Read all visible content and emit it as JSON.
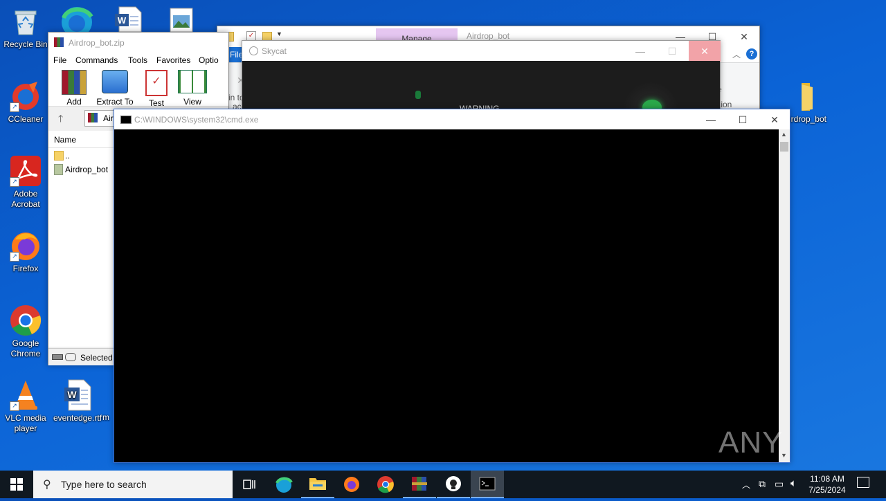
{
  "desktop": {
    "icons": [
      {
        "label": "Recycle Bin",
        "icon": "recycle-bin-icon"
      },
      {
        "label": "CCleaner",
        "icon": "ccleaner-icon"
      },
      {
        "label": "Adobe Acrobat",
        "icon": "adobe-acrobat-icon"
      },
      {
        "label": "Firefox",
        "icon": "firefox-icon"
      },
      {
        "label": "Google Chrome",
        "icon": "chrome-icon"
      },
      {
        "label": "VLC media player",
        "icon": "vlc-icon"
      },
      {
        "label": "eventedge.rtf",
        "icon": "word-document-icon"
      },
      {
        "label": "m",
        "icon": "document-icon"
      },
      {
        "label": "irdrop_bot",
        "icon": "folder-icon"
      }
    ]
  },
  "winrar": {
    "title": "Airdrop_bot.zip",
    "menu": [
      "File",
      "Commands",
      "Tools",
      "Favorites",
      "Optio"
    ],
    "toolbar": [
      {
        "label": "Add",
        "icon": "add-archive-icon"
      },
      {
        "label": "Extract To",
        "icon": "extract-icon"
      },
      {
        "label": "Test",
        "icon": "test-icon"
      },
      {
        "label": "View",
        "icon": "view-book-icon"
      }
    ],
    "path_text": "Air",
    "column_name": "Name",
    "files": [
      {
        "name": "..",
        "icon": "folder-up-icon"
      },
      {
        "name": "Airdrop_bot",
        "icon": "file-icon"
      }
    ],
    "status_text": "Selected"
  },
  "explorer": {
    "manage_tab": "Manage",
    "title": "Airdrop_bot",
    "file_tab": "File",
    "ribbon_partial_left": "Pin to",
    "ribbon_partial_left2": "ac",
    "ribbon_partial_right": "e",
    "ribbon_partial_right2": "tion"
  },
  "skycat": {
    "title": "Skycat",
    "warning_text": "WARNING"
  },
  "cmd": {
    "title": "C:\\WINDOWS\\system32\\cmd.exe"
  },
  "taskbar": {
    "search_placeholder": "Type here to search",
    "time": "11:08 AM",
    "date": "7/25/2024"
  },
  "watermark": "ANY RUN",
  "colors": {
    "desktop_blue": "#0b63d6",
    "explorer_file_tab": "#1a6fd4",
    "manage_tab": "#e5c6f0",
    "close_hover_red": "#f2a3a8",
    "taskbar": "#101820"
  }
}
